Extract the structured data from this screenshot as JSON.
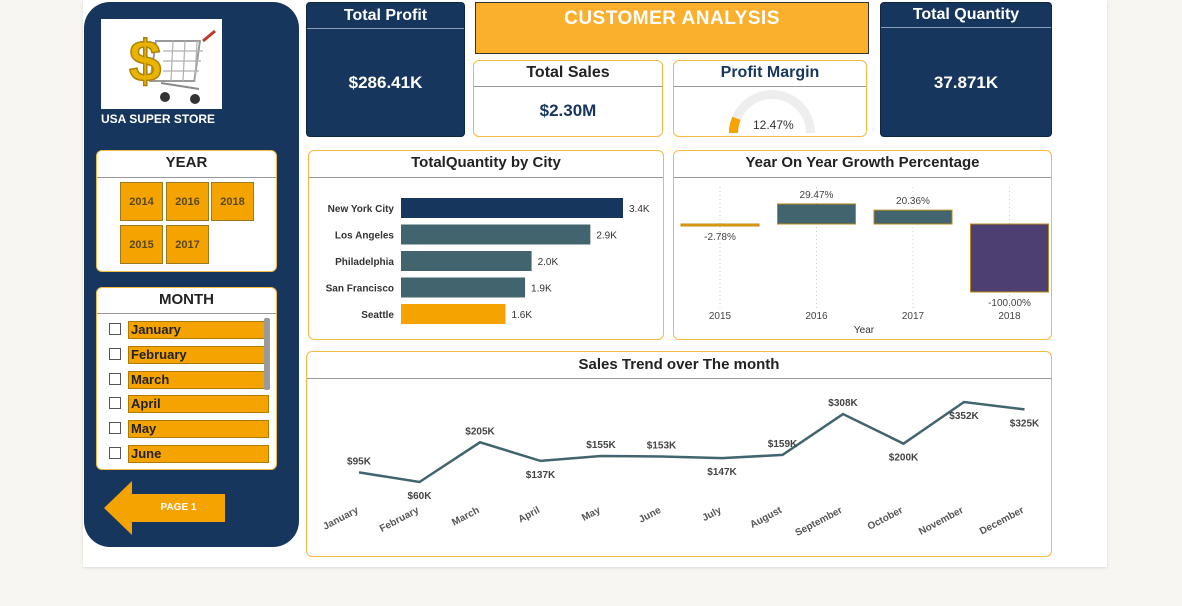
{
  "sidebar": {
    "store_name": "USA SUPER STORE",
    "year_title": "YEAR",
    "years": [
      "2014",
      "2016",
      "2018",
      "2015",
      "2017"
    ],
    "month_title": "MONTH",
    "months": [
      "January",
      "February",
      "March",
      "April",
      "May",
      "June"
    ],
    "page_button": "PAGE 1",
    "logo_icon": "dollar-shopping-cart-icon"
  },
  "header": {
    "title": "CUSTOMER ANALYSIS"
  },
  "kpis": {
    "total_profit": {
      "title": "Total Profit",
      "value": "$286.41K"
    },
    "total_sales": {
      "title": "Total Sales",
      "value": "$2.30M"
    },
    "profit_margin": {
      "title": "Profit Margin",
      "value": "12.47%",
      "fraction": 0.1247
    },
    "total_quantity": {
      "title": "Total Quantity",
      "value": "37.871K"
    }
  },
  "colors": {
    "navy": "#17365d",
    "orange": "#f5a300",
    "teal": "#41646e",
    "purple": "#4e3f73",
    "gold_border": "#f5b942"
  },
  "chart_data": [
    {
      "type": "bar",
      "orientation": "horizontal",
      "title": "TotalQuantity by City",
      "categories": [
        "New York City",
        "Los Angeles",
        "Philadelphia",
        "San Francisco",
        "Seattle"
      ],
      "values": [
        3400,
        2900,
        2000,
        1900,
        1600
      ],
      "labels": [
        "3.4K",
        "2.9K",
        "2.0K",
        "1.9K",
        "1.6K"
      ],
      "bar_colors": [
        "#17365d",
        "#41646e",
        "#41646e",
        "#41646e",
        "#f5a300"
      ]
    },
    {
      "type": "bar",
      "title": "Year On Year Growth Percentage",
      "xlabel": "Year",
      "categories": [
        "2015",
        "2016",
        "2017",
        "2018"
      ],
      "values": [
        -2.78,
        29.47,
        20.36,
        -100.0
      ],
      "labels": [
        "-2.78%",
        "29.47%",
        "20.36%",
        "-100.00%"
      ],
      "bar_colors": [
        "#f5a300",
        "#41646e",
        "#41646e",
        "#4e3f73"
      ]
    },
    {
      "type": "line",
      "title": "Sales Trend over The month",
      "categories": [
        "January",
        "February",
        "March",
        "April",
        "May",
        "June",
        "July",
        "August",
        "September",
        "October",
        "November",
        "December"
      ],
      "values": [
        95,
        60,
        205,
        137,
        155,
        153,
        147,
        159,
        308,
        200,
        352,
        325
      ],
      "labels": [
        "$95K",
        "$60K",
        "$205K",
        "$137K",
        "$155K",
        "$153K",
        "$147K",
        "$159K",
        "$308K",
        "$200K",
        "$352K",
        "$325K"
      ],
      "label_position": [
        "above",
        "below",
        "above",
        "below",
        "above",
        "above",
        "below",
        "above",
        "above",
        "below",
        "below",
        "below"
      ],
      "line_color": "#41646e"
    }
  ]
}
